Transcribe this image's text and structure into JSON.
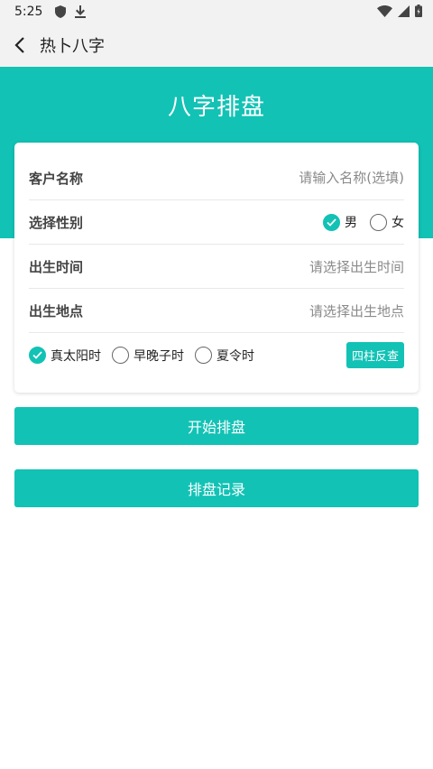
{
  "status_bar": {
    "time": "5:25"
  },
  "app_bar": {
    "title": "热卜八字"
  },
  "banner": {
    "title": "八字排盘"
  },
  "form": {
    "name": {
      "label": "客户名称",
      "placeholder": "请输入名称(选填)"
    },
    "gender": {
      "label": "选择性别",
      "options": [
        "男",
        "女"
      ],
      "selected": "男"
    },
    "birth_time": {
      "label": "出生时间",
      "placeholder": "请选择出生时间"
    },
    "birth_place": {
      "label": "出生地点",
      "placeholder": "请选择出生地点"
    },
    "time_options": [
      "真太阳时",
      "早晚子时",
      "夏令时"
    ],
    "time_selected": "真太阳时",
    "reverse_btn": "四柱反查"
  },
  "buttons": {
    "start": "开始排盘",
    "records": "排盘记录"
  },
  "colors": {
    "accent": "#12c2b5",
    "status_bg": "#f2f2f2"
  }
}
